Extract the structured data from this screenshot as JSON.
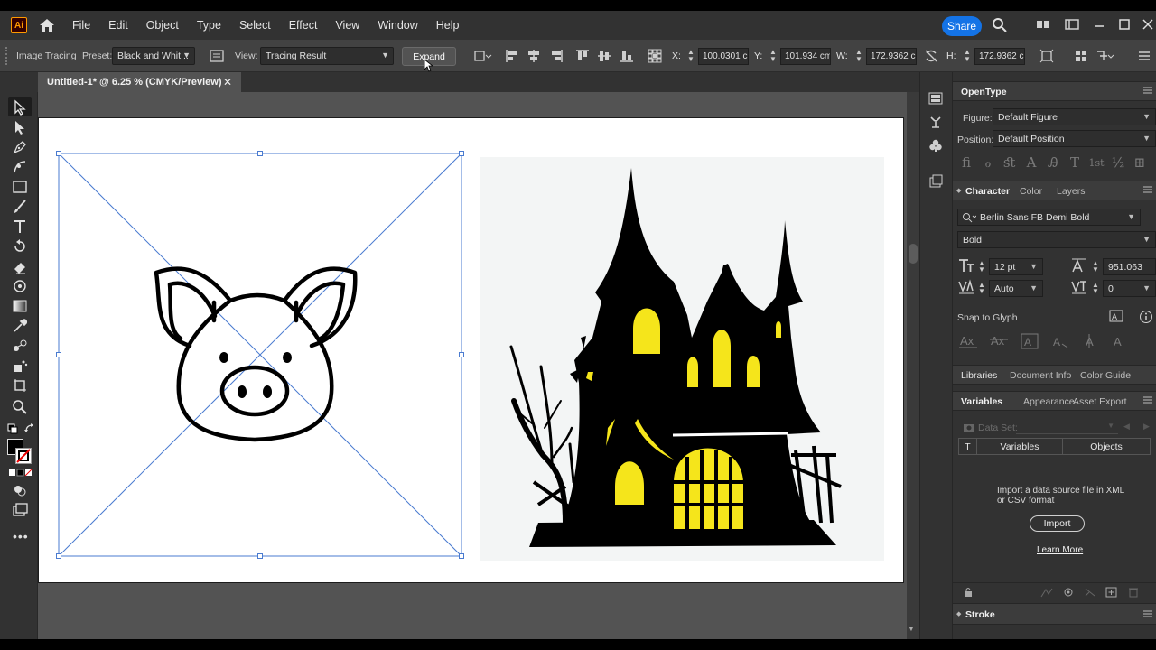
{
  "app": {
    "logo_text": "Ai"
  },
  "menu": [
    "File",
    "Edit",
    "Object",
    "Type",
    "Select",
    "Effect",
    "View",
    "Window",
    "Help"
  ],
  "share_label": "Share",
  "control": {
    "mode_label": "Image Tracing",
    "preset_label": "Preset:",
    "preset_value": "Black and Whit...",
    "view_label": "View:",
    "view_value": "Tracing Result",
    "expand_label": "Expand",
    "x_label": "X:",
    "x_value": "100.0301 ci",
    "y_label": "Y:",
    "y_value": "101.934 cm",
    "w_label": "W:",
    "w_value": "172.9362 ci",
    "h_label": "H:",
    "h_value": "172.9362 ci"
  },
  "document_tab": {
    "title": "Untitled-1* @ 6.25 % (CMYK/Preview)",
    "close": "✕"
  },
  "panels": {
    "opentype": {
      "title": "OpenType",
      "figure_label": "Figure:",
      "figure_value": "Default Figure",
      "position_label": "Position:",
      "position_value": "Default Position",
      "glyphs": [
        "ﬁ",
        "ℴ",
        "ﬆ",
        "A",
        "Ꭿ",
        "T",
        "1st",
        "½",
        "⊞"
      ]
    },
    "character": {
      "tabs": [
        "Character",
        "Color",
        "Layers"
      ],
      "font_family": "Berlin Sans FB Demi Bold",
      "font_style": "Bold",
      "font_size": "12 pt",
      "leading": "951.063",
      "kerning": "Auto",
      "tracking": "0",
      "snap_label": "Snap to Glyph"
    },
    "libraries_tabs": [
      "Libraries",
      "Document Info",
      "Color Guide"
    ],
    "variables": {
      "tabs": [
        "Variables",
        "Appearance",
        "Asset Export"
      ],
      "dataset_label": "Data Set:",
      "col_type": "T",
      "col_variables": "Variables",
      "col_objects": "Objects",
      "import_message": "Import a data source file in XML or CSV format",
      "import_label": "Import",
      "learn_more": "Learn More"
    },
    "stroke": {
      "title": "Stroke"
    }
  },
  "colors": {
    "accent": "#1473e6",
    "selection": "#4a7bd0",
    "window_yellow": "#f5e51b"
  }
}
